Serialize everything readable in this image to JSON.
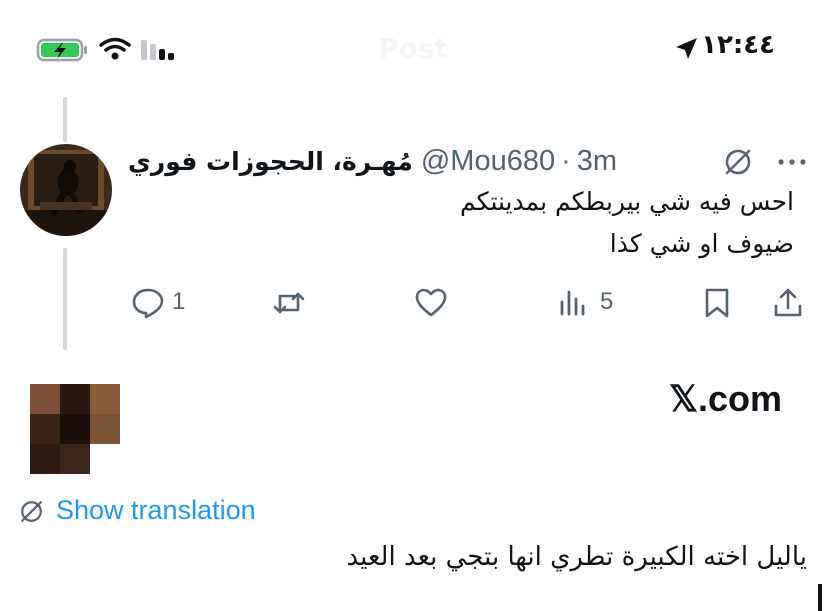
{
  "status_bar": {
    "time": "١٢:٤٤",
    "faded_title": "Post"
  },
  "tweet": {
    "display_name": "مُهـرة، الحجوزات فوري",
    "handle": "@Mou680",
    "separator": "·",
    "time_ago": "3m",
    "text_line_1": "احس فيه شي بيربطكم بمدينتكم",
    "text_line_2": "ضيوف او شي كذا",
    "reply_count": "1",
    "views_count": "5"
  },
  "link_card": {
    "domain": "𝕏.com",
    "pixel_colors": [
      "#7a4e37",
      "#2a1710",
      "#8a5a3a",
      "#3a2418",
      "#1c100c",
      "#7b5336",
      "#2d1b12",
      "#3b2419",
      "#ffffff"
    ]
  },
  "translation": {
    "label": "Show translation"
  },
  "comment": {
    "text": "ياليل اخته الكبيرة تطري انها بتجي بعد العيد"
  },
  "colors": {
    "accent": "#1d9bf0",
    "secondary_text": "#536471",
    "battery_green": "#34c759"
  }
}
